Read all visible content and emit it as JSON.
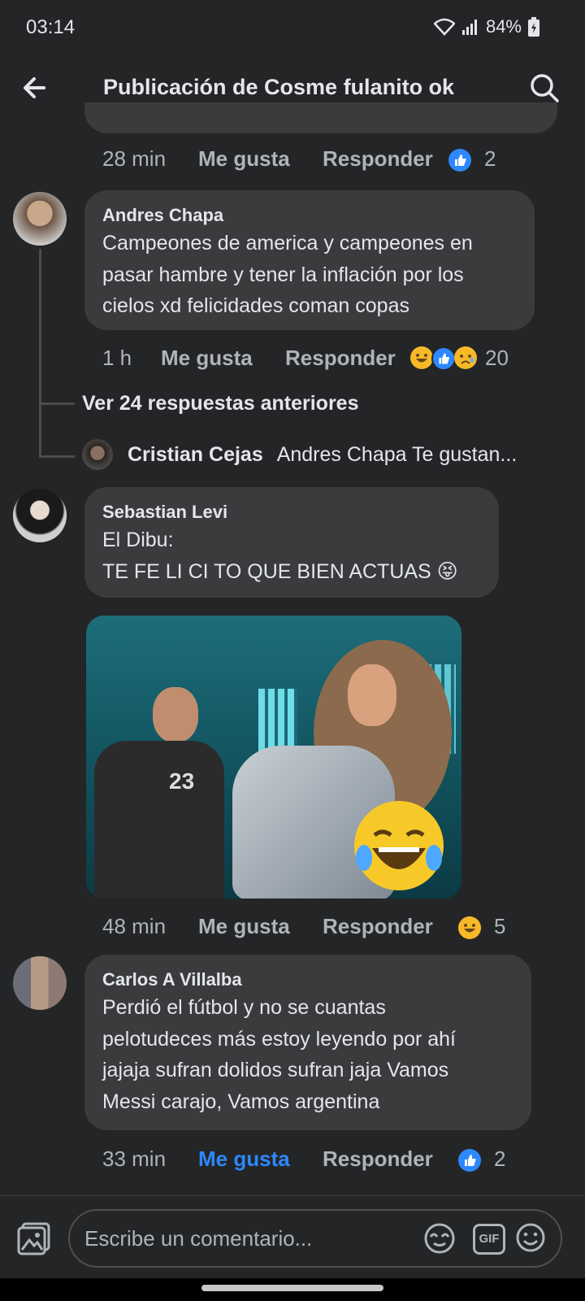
{
  "status_bar": {
    "time": "03:14",
    "battery": "84%"
  },
  "header": {
    "title": "Publicación de Cosme fulanito ok"
  },
  "comments": [
    {
      "time": "28 min",
      "like_label": "Me gusta",
      "reply_label": "Responder",
      "reaction_count": "2"
    },
    {
      "author": "Andres Chapa",
      "lines": [
        "Campeones de america y campeones en",
        "pasar hambre y tener la inflación por los",
        "cielos xd felicidades coman copas"
      ],
      "time": "1 h",
      "like_label": "Me gusta",
      "reply_label": "Responder",
      "reaction_count": "20",
      "more_replies": "Ver 24 respuestas anteriores",
      "reply_preview": {
        "author": "Cristian Cejas",
        "text": "Andres Chapa Te gustan..."
      }
    },
    {
      "author": "Sebastian Levi",
      "lines": [
        "El Dibu:",
        "TE FE LI CI TO QUE BIEN ACTUAS 😝"
      ],
      "image_jersey_number": "23",
      "time": "48 min",
      "like_label": "Me gusta",
      "reply_label": "Responder",
      "reaction_count": "5"
    },
    {
      "author": "Carlos A Villalba",
      "lines": [
        "Perdió el fútbol y no se cuantas",
        "pelotudeces más estoy leyendo por ahí",
        "jajaja sufran dolidos sufran jaja Vamos",
        "Messi carajo, Vamos argentina"
      ],
      "time": "33 min",
      "like_label": "Me gusta",
      "reply_label": "Responder",
      "reaction_count": "2",
      "liked": true
    }
  ],
  "composer": {
    "placeholder": "Escribe un comentario..."
  },
  "colors": {
    "background": "#242526",
    "bubble": "#3a3b3c",
    "accent": "#2d88ff",
    "muted": "#b0b3b8"
  }
}
